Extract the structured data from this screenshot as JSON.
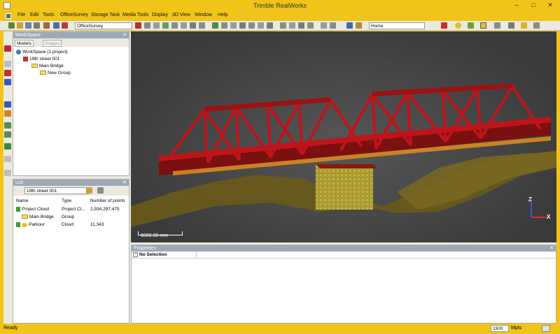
{
  "window": {
    "title": "Trimble RealWorks",
    "minimize": "–",
    "maximize": "□",
    "close": "✕"
  },
  "menus": [
    "File",
    "Edit",
    "Tools",
    "OfficeSurvey",
    "Storage Tank",
    "Media Tools",
    "Display",
    "3D View",
    "Window",
    "Help"
  ],
  "toolbar": {
    "module_combo": "OfficeSurvey",
    "view_combo": "Home"
  },
  "workspace": {
    "title": "WorkSpace",
    "tabs": [
      "Models",
      "Images"
    ],
    "tree": [
      {
        "label": "WorkSpace  (1 project)",
        "depth": 0
      },
      {
        "label": "19th street 001",
        "depth": 1
      },
      {
        "label": "Main Bridge",
        "depth": 2
      },
      {
        "label": "New Group",
        "depth": 3
      }
    ]
  },
  "list": {
    "title": "List",
    "combo": "19th street 001",
    "headers": [
      "Name",
      "Type",
      "Number of points"
    ],
    "rows": [
      {
        "name": "Project Cloud",
        "type": "Project Cl...",
        "points": "2,934,297,475"
      },
      {
        "name": "Main Bridge",
        "type": "Group",
        "points": ""
      },
      {
        "name": "Parkour",
        "type": "Cloud",
        "points": "11,343"
      }
    ]
  },
  "viewport": {
    "scale_label": "6000.00 mm",
    "axis_z": "Z",
    "axis_x": "X"
  },
  "properties": {
    "title": "Properties",
    "selection": "No Selection"
  },
  "status": {
    "left": "Ready",
    "points_value": "1500",
    "points_unit": "Mpts"
  },
  "colors": {
    "chrome": "#f0c419",
    "panel_header": "#9ea9b8",
    "bridge": "#c0141a",
    "viewport_bg": "#474747"
  }
}
